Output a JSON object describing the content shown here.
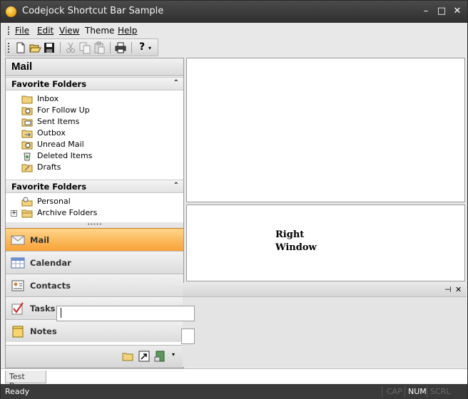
{
  "app": {
    "title": "Codejock Shortcut Bar Sample"
  },
  "window_buttons": {
    "minimize": "–",
    "maximize": "□",
    "close": "✕"
  },
  "menu": [
    "File",
    "Edit",
    "View",
    "Theme",
    "Help"
  ],
  "toolbar": {
    "icons": [
      "new-icon",
      "open-icon",
      "save-icon",
      "cut-icon",
      "copy-icon",
      "paste-icon",
      "print-icon",
      "help-icon"
    ]
  },
  "shortcut_bar": {
    "title": "Mail",
    "groups": [
      {
        "title": "Favorite Folders",
        "items": [
          "Inbox",
          "For Follow Up",
          "Sent Items",
          "Outbox",
          "Unread Mail",
          "Deleted Items",
          "Drafts"
        ]
      },
      {
        "title": "Favorite Folders",
        "items": [
          "Personal",
          "Archive Folders"
        ]
      }
    ],
    "nav": [
      {
        "label": "Mail",
        "active": true
      },
      {
        "label": "Calendar",
        "active": false
      },
      {
        "label": "Contacts",
        "active": false
      },
      {
        "label": "Tasks",
        "active": false
      },
      {
        "label": "Notes",
        "active": false
      }
    ]
  },
  "right_window": {
    "label": "Right\nWindow"
  },
  "pane": {
    "tab_label": "Test Pane"
  },
  "status": {
    "text": "Ready",
    "indicators": [
      {
        "label": "CAP",
        "active": false
      },
      {
        "label": "NUM",
        "active": true
      },
      {
        "label": "SCRL",
        "active": false
      }
    ]
  },
  "colors": {
    "accent": "#f8a236",
    "titlebar": "#3a3a3a",
    "statusbar": "#3a3a3a"
  }
}
